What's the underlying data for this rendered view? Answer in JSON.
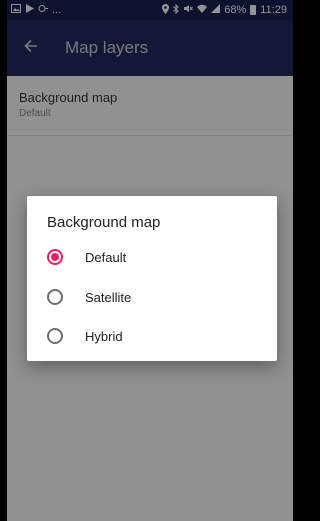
{
  "status_bar": {
    "left_dots": "...",
    "battery": "68%",
    "time": "11:29"
  },
  "app_bar": {
    "title": "Map layers"
  },
  "preference": {
    "title": "Background map",
    "summary": "Default"
  },
  "dialog": {
    "title": "Background map",
    "options": [
      {
        "label": "Default",
        "selected": true
      },
      {
        "label": "Satellite",
        "selected": false
      },
      {
        "label": "Hybrid",
        "selected": false
      }
    ]
  },
  "colors": {
    "primary": "#23295e",
    "status_bar": "#1a1f52",
    "accent": "#e91e63"
  }
}
